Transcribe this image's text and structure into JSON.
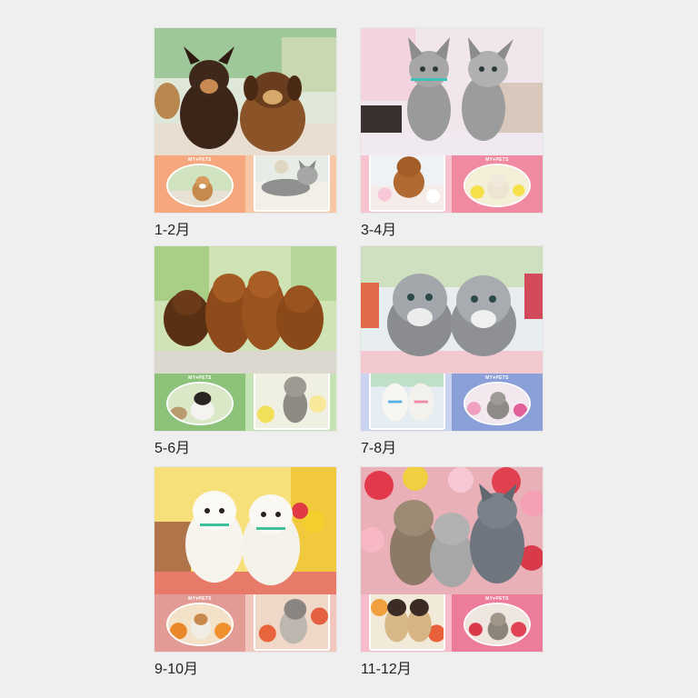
{
  "brand_text": "MY♥PETS",
  "months": [
    {
      "label": "1-2月",
      "theme": "#f6a77d",
      "accent": "#f7c8a6"
    },
    {
      "label": "3-4月",
      "theme": "#f08aa0",
      "accent": "#f7c3cf"
    },
    {
      "label": "5-6月",
      "theme": "#8cc27a",
      "accent": "#c6e3b6"
    },
    {
      "label": "7-8月",
      "theme": "#8b9fd8",
      "accent": "#c9d3f0"
    },
    {
      "label": "9-10月",
      "theme": "#e39c95",
      "accent": "#f1c7c0"
    },
    {
      "label": "11-12月",
      "theme": "#ec7c9a",
      "accent": "#f6bccb"
    }
  ]
}
